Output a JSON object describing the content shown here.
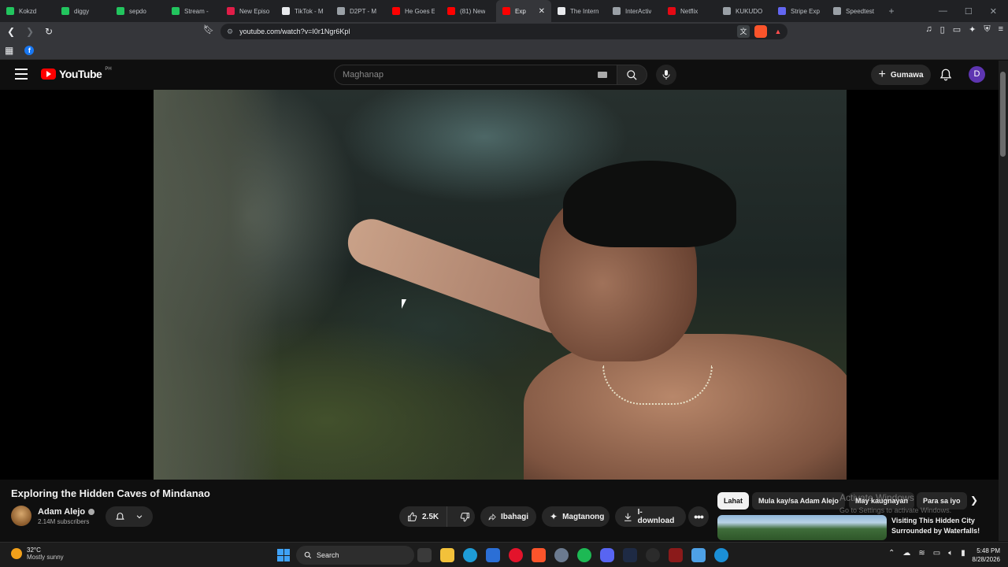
{
  "browser": {
    "tabs": [
      {
        "label": "Kokzd",
        "color": "#22c55e"
      },
      {
        "label": "diggy",
        "color": "#22c55e"
      },
      {
        "label": "sepdo",
        "color": "#22c55e"
      },
      {
        "label": "Stream -",
        "color": "#22c55e"
      },
      {
        "label": "New Episo",
        "color": "#e11d48"
      },
      {
        "label": "TikTok - M",
        "color": "#e8eaed"
      },
      {
        "label": "D2PT - M",
        "color": "#9aa0a6"
      },
      {
        "label": "He Goes E",
        "color": "#ff0000"
      },
      {
        "label": "(81) New",
        "color": "#ff0000"
      },
      {
        "label": "Exp",
        "color": "#ff0000",
        "active": true
      },
      {
        "label": "The Intern",
        "color": "#e8eaed"
      },
      {
        "label": "InterActiv",
        "color": "#9aa0a6"
      },
      {
        "label": "Netflix",
        "color": "#e50914"
      },
      {
        "label": "KUKUDO",
        "color": "#9aa0a6"
      },
      {
        "label": "Stripe Exp",
        "color": "#6366f1"
      },
      {
        "label": "Speedtest",
        "color": "#9aa0a6"
      }
    ],
    "url": "youtube.com/watch?v=I0r1Ngr6Kpl"
  },
  "youtube": {
    "logo_text": "YouTube",
    "country_code": "PH",
    "search_placeholder": "Maghanap",
    "create_label": "Gumawa",
    "avatar_letter": "D"
  },
  "video": {
    "title": "Exploring the Hidden Caves of Mindanao",
    "channel_name": "Adam Alejo",
    "subscribers": "2.14M subscribers",
    "likes": "2.5K",
    "share_label": "Ibahagi",
    "ask_label": "Magtanong",
    "download_label": "I-download"
  },
  "related": {
    "chips": [
      "Lahat",
      "Mula kay/sa Adam Alejo",
      "May kaugnayan",
      "Para sa iyo"
    ],
    "first_title": "Visiting This Hidden City Surrounded by Waterfalls!"
  },
  "watermark": {
    "line1": "Activate Windows",
    "line2": "Go to Settings to activate Windows."
  },
  "taskbar": {
    "temperature": "32°C",
    "condition": "Mostly sunny",
    "search_label": "Search",
    "time": "5:48 PM",
    "date": "8/28/2026"
  }
}
